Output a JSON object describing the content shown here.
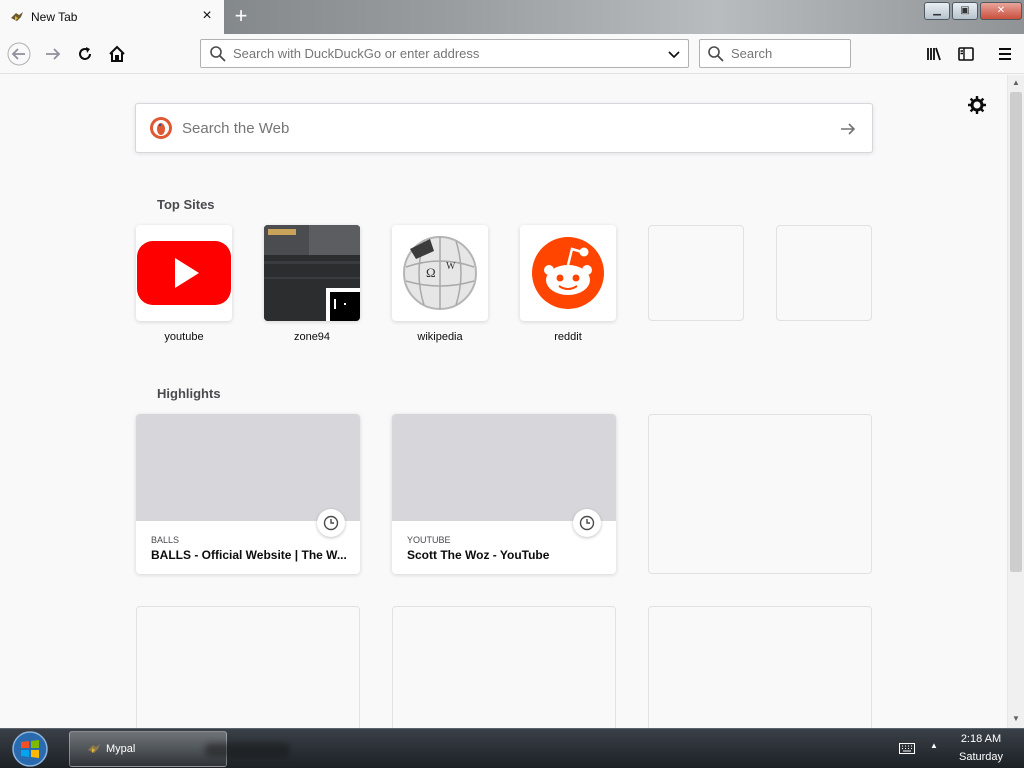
{
  "tab": {
    "title": "New Tab",
    "close_glyph": "×"
  },
  "newtab": {
    "glyph": "+"
  },
  "window_controls": {
    "minimize": "▁",
    "restore": "▣",
    "close": "✕"
  },
  "navbar": {
    "url_placeholder": "Search with DuckDuckGo or enter address",
    "search_placeholder": "Search"
  },
  "content": {
    "websearch_placeholder": "Search the Web",
    "top_sites_title": "Top Sites",
    "highlights_title": "Highlights",
    "top_sites": [
      {
        "label": "youtube",
        "icon": "youtube-icon"
      },
      {
        "label": "zone94",
        "icon": "zone94-thumbnail"
      },
      {
        "label": "wikipedia",
        "icon": "wikipedia-icon"
      },
      {
        "label": "reddit",
        "icon": "reddit-icon"
      },
      {
        "label": "",
        "icon": ""
      },
      {
        "label": "",
        "icon": ""
      }
    ],
    "highlights": [
      {
        "source": "BALLS",
        "title": "BALLS - Official Website | The W..."
      },
      {
        "source": "YOUTUBE",
        "title": "Scott The Woz - YouTube"
      }
    ]
  },
  "scrollbar": {
    "up": "▲",
    "down": "▼"
  },
  "taskbar": {
    "task_label": "Mypal",
    "time": "2:18 AM",
    "day": "Saturday",
    "tray_up": "▲"
  },
  "colors": {
    "youtube_red": "#ff0000",
    "reddit_orange": "#ff4500",
    "ddg_orange": "#de5833"
  }
}
